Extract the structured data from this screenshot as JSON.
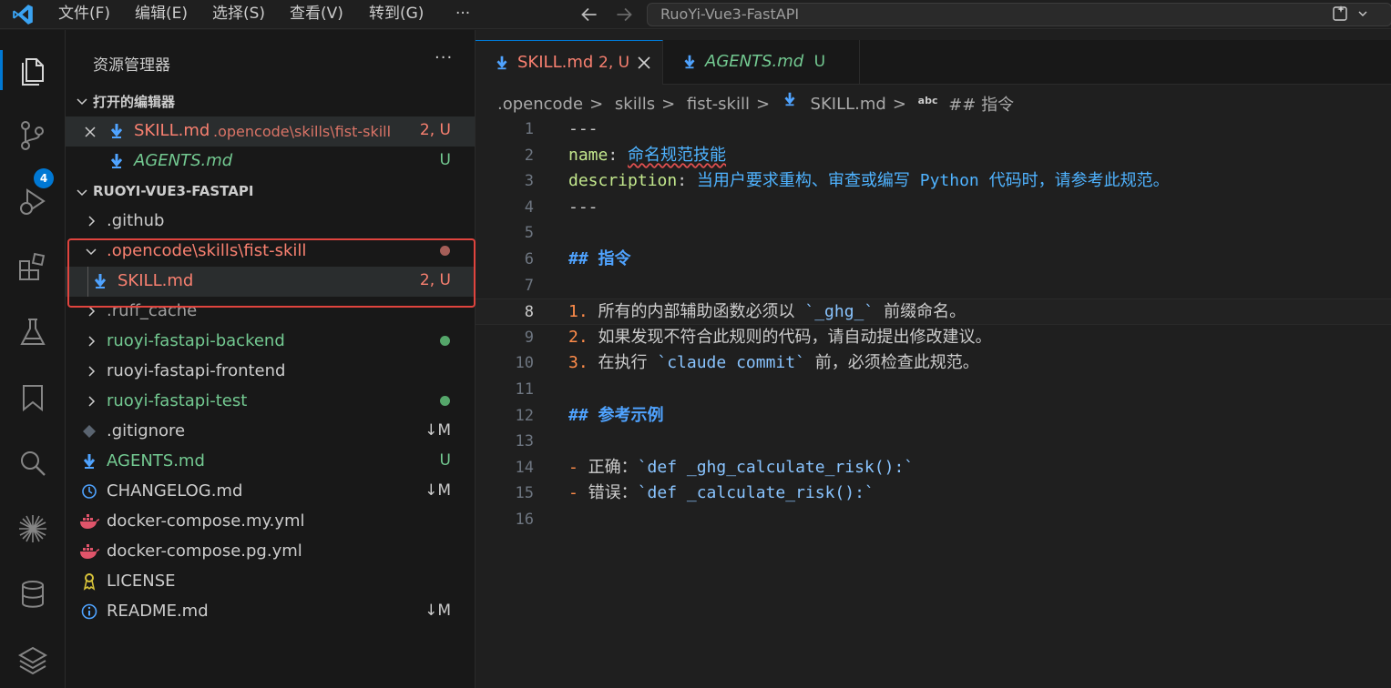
{
  "titlebar": {
    "menus": [
      "文件(F)",
      "编辑(E)",
      "选择(S)",
      "查看(V)",
      "转到(G)",
      "···"
    ],
    "command_center": "RuoYi-Vue3-FastAPI"
  },
  "activitybar": {
    "items": [
      "explorer-icon",
      "source-control-icon",
      "run-debug-icon",
      "extensions-icon",
      "testing-icon",
      "bookmarks-icon",
      "search-icon",
      "sparkle-icon",
      "database-icon",
      "layers-icon"
    ],
    "scm_badge": "4"
  },
  "sidebar": {
    "title": "资源管理器",
    "more": "···",
    "open_editors": {
      "header": "打开的编辑器",
      "items": [
        {
          "name": "SKILL.md",
          "path": ".opencode\\skills\\fist-skill",
          "badge": "2, U"
        },
        {
          "name": "AGENTS.md",
          "badge": "U"
        }
      ]
    },
    "workspace": {
      "header": "RUOYI-VUE3-FASTAPI",
      "items": [
        {
          "name": ".github",
          "badge": ""
        },
        {
          "name": ".opencode\\skills\\fist-skill",
          "badge": ""
        },
        {
          "name": "SKILL.md",
          "badge": "2, U"
        },
        {
          "name": ".ruff_cache",
          "badge": ""
        },
        {
          "name": "ruoyi-fastapi-backend",
          "badge": ""
        },
        {
          "name": "ruoyi-fastapi-frontend",
          "badge": ""
        },
        {
          "name": "ruoyi-fastapi-test",
          "badge": ""
        },
        {
          "name": ".gitignore",
          "badge": "↓M"
        },
        {
          "name": "AGENTS.md",
          "badge": "U"
        },
        {
          "name": "CHANGELOG.md",
          "badge": "↓M"
        },
        {
          "name": "docker-compose.my.yml",
          "badge": ""
        },
        {
          "name": "docker-compose.pg.yml",
          "badge": ""
        },
        {
          "name": "LICENSE",
          "badge": ""
        },
        {
          "name": "README.md",
          "badge": "↓M"
        }
      ]
    }
  },
  "editor": {
    "tabs": [
      {
        "label": "SKILL.md",
        "badge": "2, U"
      },
      {
        "label": "AGENTS.md",
        "badge": "U"
      }
    ],
    "breadcrumb": [
      ".opencode",
      "skills",
      "fist-skill",
      "SKILL.md",
      "## 指令"
    ],
    "breadcrumb_abc": "abc",
    "lines": [
      {
        "n": "1",
        "text": "---"
      },
      {
        "n": "2",
        "key": "name",
        "sep": ": ",
        "val": "命名规范技能"
      },
      {
        "n": "3",
        "key": "description",
        "sep": ": ",
        "val": "当用户要求重构、审查或编写 Python 代码时，请参考此规范。"
      },
      {
        "n": "4",
        "text": "---"
      },
      {
        "n": "5",
        "text": ""
      },
      {
        "n": "6",
        "text": "## 指令"
      },
      {
        "n": "7",
        "text": ""
      },
      {
        "n": "8",
        "num": "1.",
        "pre": " 所有的内部辅助函数必须以 ",
        "code": "`_ghg_`",
        "post": " 前缀命名。"
      },
      {
        "n": "9",
        "num": "2.",
        "pre": " 如果发现不符合此规则的代码，请自动提出修改建议。",
        "code": "",
        "post": ""
      },
      {
        "n": "10",
        "num": "3.",
        "pre": " 在执行 ",
        "code": "`claude commit`",
        "post": " 前，必须检查此规范。"
      },
      {
        "n": "11",
        "text": ""
      },
      {
        "n": "12",
        "text": "## 参考示例"
      },
      {
        "n": "13",
        "text": ""
      },
      {
        "n": "14",
        "dash": "-",
        "pre": " 正确：",
        "code": "`def _ghg_calculate_risk():`"
      },
      {
        "n": "15",
        "dash": "-",
        "pre": " 错误：",
        "code": "`def _calculate_risk():`"
      },
      {
        "n": "16",
        "text": ""
      }
    ]
  },
  "colors": {
    "accent": "#0078d4",
    "modified_red": "#f88070",
    "untracked_green": "#73c991",
    "highlight_box": "#e0443e"
  }
}
